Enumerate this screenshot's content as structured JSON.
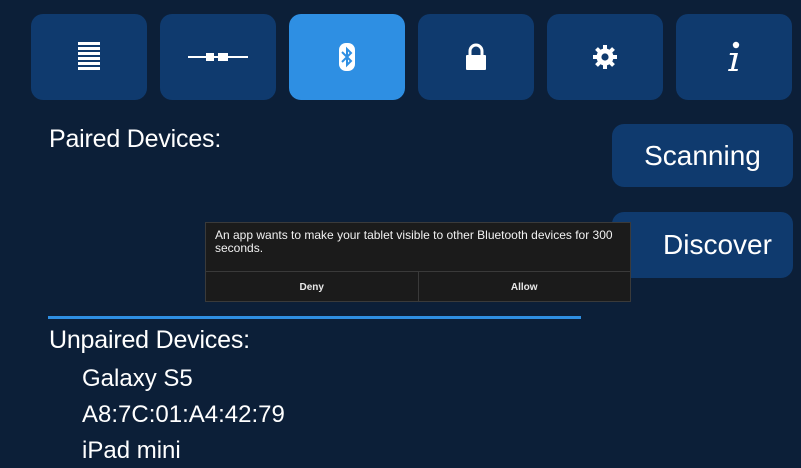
{
  "tabs": [
    {
      "name": "list-icon",
      "active": false
    },
    {
      "name": "connection-icon",
      "active": false
    },
    {
      "name": "bluetooth-icon",
      "active": true
    },
    {
      "name": "lock-icon",
      "active": false
    },
    {
      "name": "gear-icon",
      "active": false
    },
    {
      "name": "info-icon",
      "active": false
    }
  ],
  "paired": {
    "label": "Paired Devices:"
  },
  "unpaired": {
    "label": "Unpaired Devices:",
    "devices": [
      "Galaxy S5",
      "A8:7C:01:A4:42:79",
      "iPad mini"
    ]
  },
  "buttons": {
    "scanning": "Scanning",
    "discover": "Discover"
  },
  "dialog": {
    "message": "An app wants to make your tablet visible to other Bluetooth devices for 300 seconds.",
    "deny": "Deny",
    "allow": "Allow"
  },
  "colors": {
    "background": "#0c1f38",
    "button": "#0f3a6e",
    "accent": "#2e8fe3",
    "dialog": "#1b1b1b"
  }
}
